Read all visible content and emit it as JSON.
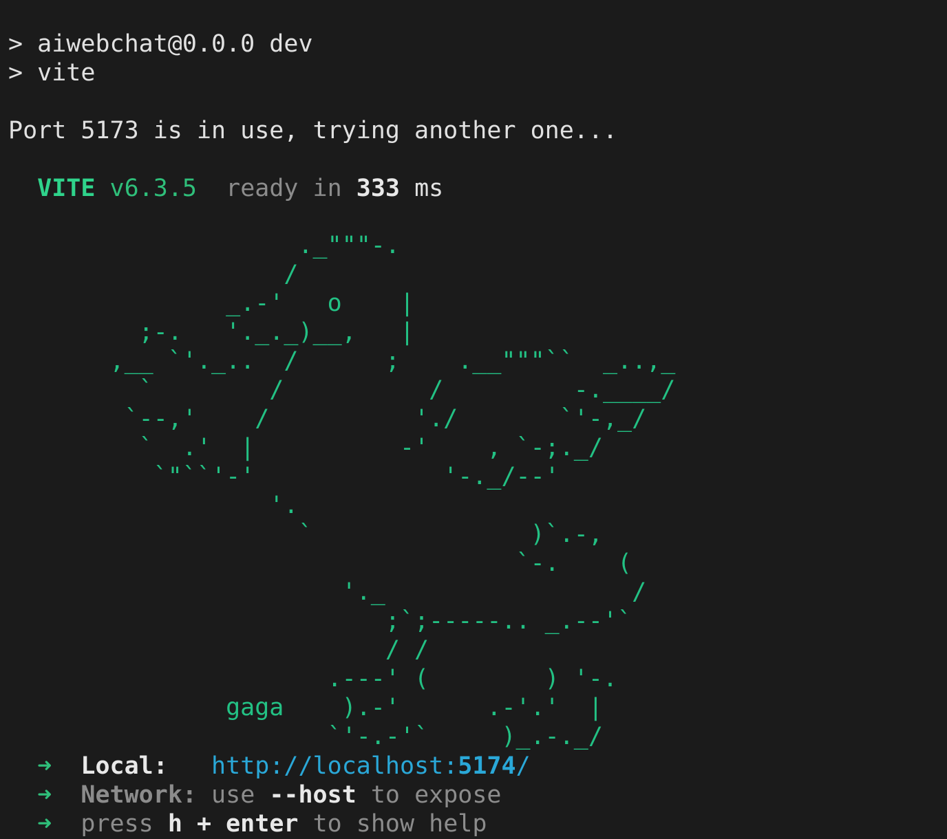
{
  "cmd": {
    "prompt_1": "> ",
    "script": "aiwebchat@0.0.0 dev",
    "prompt_2": "> ",
    "command": "vite"
  },
  "port_message": "Port 5173 is in use, trying another one...",
  "vite": {
    "name": "VITE",
    "version": "v6.3.5",
    "ready": "ready in",
    "time": "333",
    "unit": "ms"
  },
  "ascii_art": "                    ._\"\"\"-.\n                   /\n               _.-'   o    |\n         ;-.   '._._)__,   |\n       ,__ `'._..  /      ;    .__\"\"\"``  _..,_\n         `        /          /         -.____/\n        `--,'    /          './       `'-,_/\n         `  .'  |          -'    , `-;._/\n          `\"``'-'             '-._/--'\n                  '.\n                    `               )`.-,\n                                   `-.    (\n                       '._                 /\n                          ;`;-----.. _.--'`\n                          / /\n                      .---' (        ) '-.\n               gaga    ).-'      .-'.'  |\n                      `'-.-'`     )_.-._/",
  "info": {
    "arrow": "➜",
    "local_label": "Local:",
    "local_url_base": "http://localhost:",
    "local_url_port": "5174",
    "local_url_tail": "/",
    "network_label": "Network:",
    "network_pre": "use",
    "network_flag": "--host",
    "network_post": "to expose",
    "help_pre": "press",
    "help_key": "h + enter",
    "help_post": "to show help"
  },
  "colors": {
    "background": "#1b1b1b",
    "text": "#e1e1e1",
    "green": "#2fbf7a",
    "cyan": "#2aa8d8",
    "dim": "#8c8c8c"
  }
}
